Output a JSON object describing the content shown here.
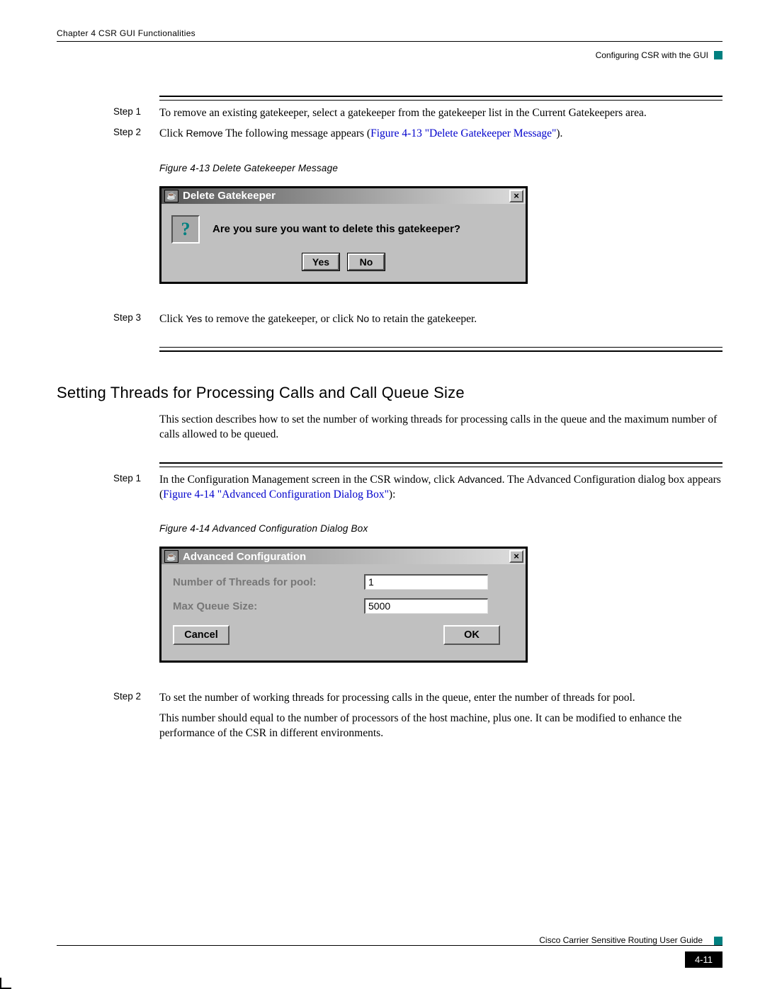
{
  "header": {
    "chapter": "Chapter 4    CSR GUI Functionalities",
    "section": "Configuring CSR with the GUI"
  },
  "steps_a": {
    "s1_label": "Step 1",
    "s1_body": "To remove an existing gatekeeper, select a gatekeeper from the gatekeeper list in the Current Gatekeepers area.",
    "s2_label": "Step 2",
    "s2_body_pre": "Click ",
    "s2_remove": "Remove",
    "s2_body_mid": " The following message appears (",
    "s2_link": "Figure 4-13 \"Delete Gatekeeper Message\"",
    "s2_body_post": ").",
    "s3_label": "Step 3",
    "s3_pre": "Click ",
    "s3_yes": "Yes",
    "s3_mid": " to remove the gatekeeper, or click ",
    "s3_no": "No",
    "s3_post": " to retain the gatekeeper."
  },
  "figure1": {
    "caption": "Figure 4-13   Delete Gatekeeper Message",
    "title": "Delete Gatekeeper",
    "message": "Are you sure you want to delete this gatekeeper?",
    "yes": "Yes",
    "no": "No",
    "close": "×",
    "qmark": "?"
  },
  "section2": {
    "heading": "Setting Threads for Processing Calls and Call Queue Size",
    "para": "This section describes how to set the number of working threads for processing calls in the queue and the maximum number of calls allowed to be queued."
  },
  "steps_b": {
    "s1_label": "Step 1",
    "s1_pre": "In the Configuration Management screen in the CSR window, click ",
    "s1_adv": "Advanced",
    "s1_mid": ". The Advanced Configuration dialog box appears (",
    "s1_link": "Figure 4-14 \"Advanced Configuration Dialog Box\"",
    "s1_post": "):",
    "s2_label": "Step 2",
    "s2_body": "To set the number of working threads for processing calls in the queue, enter the number of threads for pool.",
    "s2_note": "This number should equal to the number of processors of the host machine, plus one. It can be modified to enhance the performance of the CSR in different environments."
  },
  "figure2": {
    "caption": "Figure 4-14   Advanced Configuration Dialog Box",
    "title": "Advanced Configuration",
    "label_threads": "Number of Threads for pool:",
    "value_threads": "1",
    "label_queue": "Max Queue Size:",
    "value_queue": "5000",
    "cancel": "Cancel",
    "ok": "OK",
    "close": "×"
  },
  "footer": {
    "book": "Cisco Carrier Sensitive Routing User Guide",
    "page": "4-11"
  }
}
